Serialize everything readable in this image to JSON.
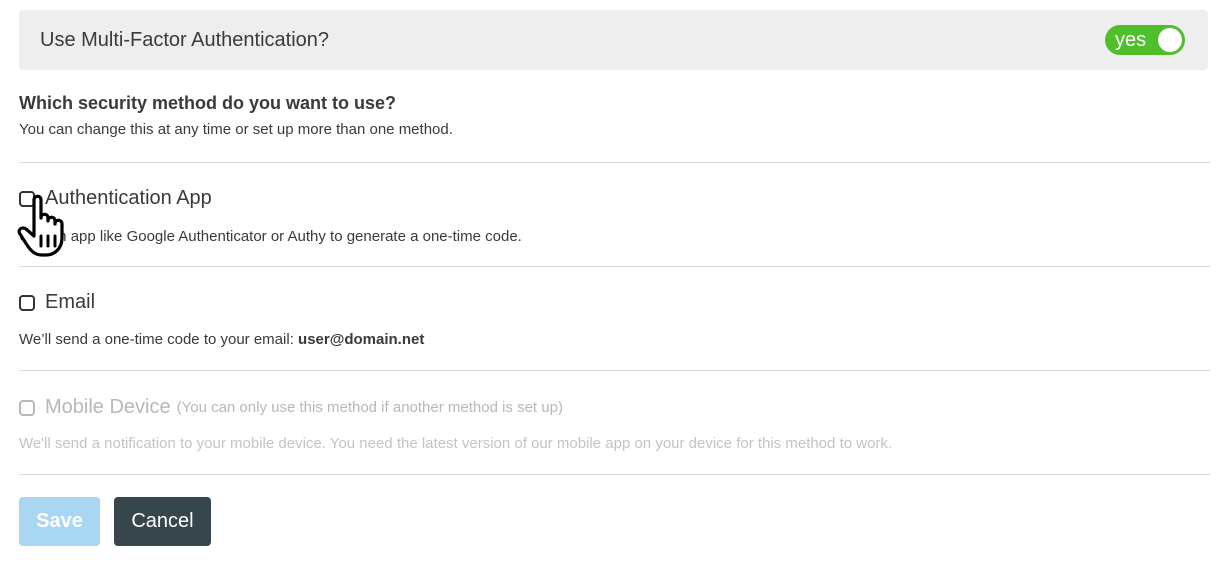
{
  "mfa": {
    "title": "Use Multi-Factor Authentication?",
    "toggle_label": "yes",
    "toggle_on": true,
    "toggle_color": "#4fbf2c"
  },
  "question": {
    "title": "Which security method do you want to use?",
    "subtitle": "You can change this at any time or set up more than one method."
  },
  "options": [
    {
      "title": "Authentication App",
      "description": "Use an app like Google Authenticator or Authy to generate a one-time code.",
      "checked": false,
      "disabled": false
    },
    {
      "title": "Email",
      "description_prefix": "We’ll send a one-time code to your email: ",
      "email": "user@domain.net",
      "checked": false,
      "disabled": false
    },
    {
      "title": "Mobile Device",
      "note": "(You can only use this method if another method is set up)",
      "description": "We'll send a notification to your mobile device. You need the latest version of our mobile app on your device for this method to work.",
      "checked": false,
      "disabled": true
    }
  ],
  "buttons": {
    "save_label": "Save",
    "cancel_label": "Cancel",
    "save_color": "#a9d6f0",
    "cancel_color": "#37454d"
  },
  "cursor": {
    "icon": "hand-pointer-icon"
  }
}
